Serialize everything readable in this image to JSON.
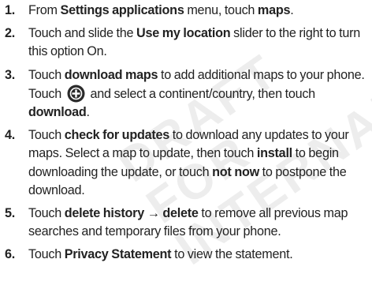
{
  "watermark": "DRAFT\nFOR\nINTERNAL",
  "icons": {
    "add": "plus-circle-icon"
  },
  "steps": [
    {
      "num": "1.",
      "p1": "From ",
      "b1": "Settings applications",
      "p2": " menu, touch ",
      "b2": "maps",
      "p3": "."
    },
    {
      "num": "2.",
      "p1": "Touch and slide the ",
      "b1": "Use my location",
      "p2": " slider to the right to turn this option On."
    },
    {
      "num": "3.",
      "p1": "Touch ",
      "b1": "download maps",
      "p2": " to add additional maps to your phone. Touch ",
      "p3": " and select a continent/country, then touch ",
      "b2": "download",
      "p4": "."
    },
    {
      "num": "4.",
      "p1": "Touch ",
      "b1": "check for updates",
      "p2": " to download any updates to your maps. Select a map to update, then touch ",
      "b2": "install",
      "p3": " to begin downloading the update, or touch ",
      "b3": "not now",
      "p4": " to postpone the download."
    },
    {
      "num": "5.",
      "p1": "Touch ",
      "b1": "delete history → delete",
      "p2": " to remove all previous map searches and temporary files from your phone."
    },
    {
      "num": "6.",
      "p1": "Touch ",
      "b1": "Privacy Statement",
      "p2": " to view the statement."
    }
  ]
}
